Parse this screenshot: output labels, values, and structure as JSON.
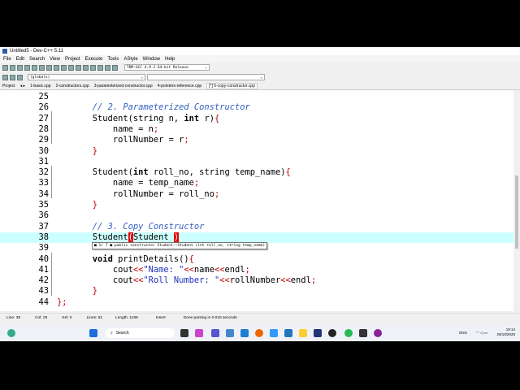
{
  "window": {
    "title": "Untitled5 - Dev-C++ 5.11"
  },
  "menu": [
    "File",
    "Edit",
    "Search",
    "View",
    "Project",
    "Execute",
    "Tools",
    "AStyle",
    "Window",
    "Help"
  ],
  "toolbar": {
    "compiler": "TDM-GCC 4.9.2 64-bit Release",
    "scope": "(globals)"
  },
  "tabs": {
    "project_label": "Project",
    "files": [
      "1-basic.cpp",
      "2-constructors.cpp",
      "3-parameterized-constructor.cpp",
      "4-pointers-reference.cpp",
      "[*] 5-copy-constructor.cpp"
    ]
  },
  "editor": {
    "current_line": 38,
    "lines": [
      {
        "n": "25",
        "t": []
      },
      {
        "n": "26",
        "t": [
          [
            "       ",
            ""
          ],
          [
            "// 2. Parameterized Constructor",
            "c"
          ]
        ]
      },
      {
        "n": "27",
        "t": [
          [
            "       Student(string n, ",
            ""
          ],
          [
            "int",
            "k"
          ],
          [
            " r)",
            ""
          ],
          [
            "{",
            "s"
          ]
        ]
      },
      {
        "n": "28",
        "t": [
          [
            "           name = n",
            ""
          ],
          [
            ";",
            "s"
          ]
        ]
      },
      {
        "n": "29",
        "t": [
          [
            "           rollNumber = r",
            ""
          ],
          [
            ";",
            "s"
          ]
        ]
      },
      {
        "n": "30",
        "t": [
          [
            "       ",
            ""
          ],
          [
            "}",
            "s"
          ]
        ]
      },
      {
        "n": "31",
        "t": []
      },
      {
        "n": "32",
        "t": [
          [
            "       Student(",
            ""
          ],
          [
            "int",
            "k"
          ],
          [
            " roll_no, string temp_name)",
            ""
          ],
          [
            "{",
            "s"
          ]
        ]
      },
      {
        "n": "33",
        "t": [
          [
            "           name = temp_name",
            ""
          ],
          [
            ";",
            "s"
          ]
        ]
      },
      {
        "n": "34",
        "t": [
          [
            "           rollNumber = roll_no",
            ""
          ],
          [
            ";",
            "s"
          ]
        ]
      },
      {
        "n": "35",
        "t": [
          [
            "       ",
            ""
          ],
          [
            "}",
            "s"
          ]
        ]
      },
      {
        "n": "36",
        "t": []
      },
      {
        "n": "37",
        "t": [
          [
            "       ",
            ""
          ],
          [
            "// 3. Copy Constructor",
            "c"
          ]
        ]
      },
      {
        "n": "38",
        "t": [
          [
            "       Student",
            ""
          ],
          [
            "(",
            "b"
          ],
          [
            "Student ",
            ""
          ],
          [
            ")",
            "b"
          ]
        ]
      },
      {
        "n": "39",
        "t": []
      },
      {
        "n": "40",
        "t": [
          [
            "       ",
            ""
          ],
          [
            "void",
            "k"
          ],
          [
            " printDetails()",
            ""
          ],
          [
            "{",
            "s"
          ]
        ]
      },
      {
        "n": "41",
        "t": [
          [
            "           cout",
            ""
          ],
          [
            "<<",
            "s"
          ],
          [
            "\"Name: \"",
            "q"
          ],
          [
            "<<",
            "s"
          ],
          [
            "name",
            ""
          ],
          [
            "<<",
            "s"
          ],
          [
            "endl",
            ""
          ],
          [
            ";",
            "s"
          ]
        ]
      },
      {
        "n": "42",
        "t": [
          [
            "           cout",
            ""
          ],
          [
            "<<",
            "s"
          ],
          [
            "\"Roll Number: \"",
            "q"
          ],
          [
            "<<",
            "s"
          ],
          [
            "rollNumber",
            ""
          ],
          [
            "<<",
            "s"
          ],
          [
            "endl",
            ""
          ],
          [
            ";",
            "s"
          ]
        ]
      },
      {
        "n": "43",
        "t": [
          [
            "       ",
            ""
          ],
          [
            "}",
            "s"
          ]
        ]
      },
      {
        "n": "44",
        "t": [
          [
            "",
            ""
          ],
          [
            "};",
            "s"
          ]
        ]
      }
    ],
    "tooltip": "■ 1/ 7 ■ public constructor Student::Student (int roll_no, string temp_name)"
  },
  "status": {
    "line": "Line:  38",
    "col": "Col:  25",
    "sel": "Sel:  0",
    "lines": "Lines:  61",
    "length": "Length:  1198",
    "mode": "Insert",
    "message": "Done parsing in 0.015 seconds"
  },
  "taskbar": {
    "search": "Search",
    "tray": "ENG",
    "time": "19:14",
    "date": "26/10/2025"
  }
}
